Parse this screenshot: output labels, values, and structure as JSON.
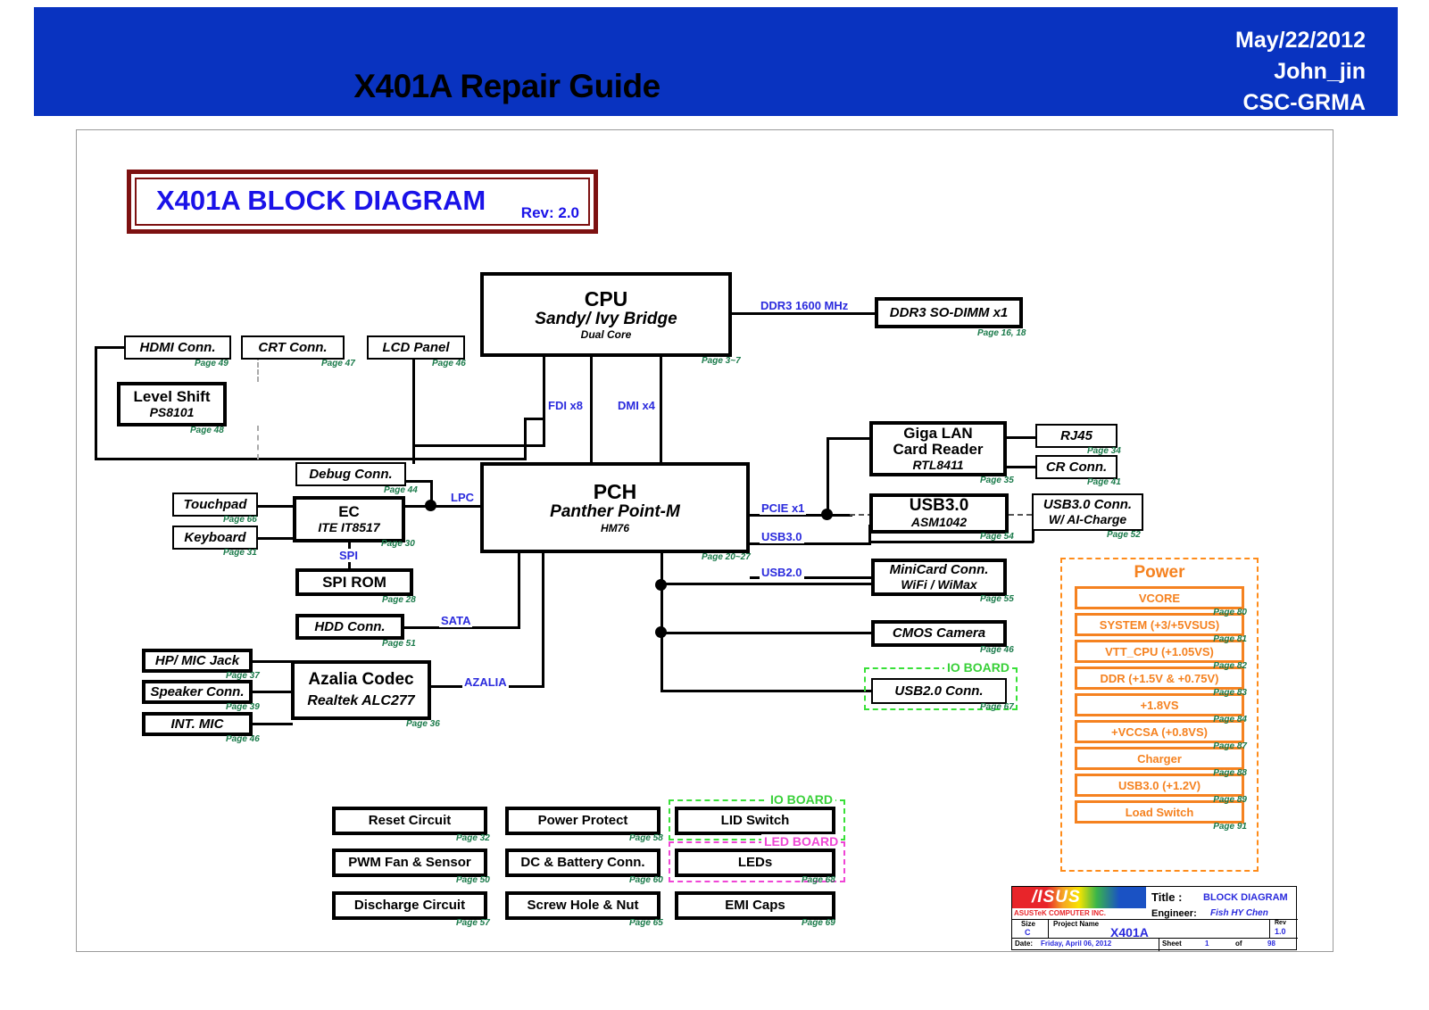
{
  "header": {
    "title": "X401A Repair Guide",
    "date": "May/22/2012",
    "author": "John_jin",
    "org": "CSC-GRMA",
    "bg_color": "#0933c0"
  },
  "diagram": {
    "title": "X401A BLOCK DIAGRAM",
    "revision": "Rev: 2.0",
    "border_color": "#7d1111",
    "title_color": "#1a12e8"
  },
  "blocks": {
    "cpu": {
      "l1": "CPU",
      "l2": "Sandy/ Ivy Bridge",
      "l3": "Dual Core",
      "page": "Page 3~7"
    },
    "ddr3_sodimm": {
      "l1": "DDR3 SO-DIMM x1",
      "page": "Page 16, 18"
    },
    "hdmi_conn": {
      "l1": "HDMI Conn.",
      "page": "Page 49"
    },
    "crt_conn": {
      "l1": "CRT Conn.",
      "page": "Page 47"
    },
    "lcd_panel": {
      "l1": "LCD Panel",
      "page": "Page 46"
    },
    "level_shift": {
      "l1": "Level Shift",
      "l2": "PS8101",
      "page": "Page 48"
    },
    "debug_conn": {
      "l1": "Debug Conn.",
      "page": "Page 44"
    },
    "touchpad": {
      "l1": "Touchpad",
      "page": "Page 66"
    },
    "keyboard": {
      "l1": "Keyboard",
      "page": "Page 31"
    },
    "ec": {
      "l1": "EC",
      "l2": "ITE IT8517",
      "page": "Page 30"
    },
    "spi_rom": {
      "l1": "SPI ROM",
      "page": "Page 28"
    },
    "pch": {
      "l1": "PCH",
      "l2": "Panther Point-M",
      "l3": "HM76",
      "page": "Page 20~27"
    },
    "hdd_conn": {
      "l1": "HDD Conn.",
      "page": "Page 51"
    },
    "hp_mic_jack": {
      "l1": "HP/ MIC Jack",
      "page": "Page 37"
    },
    "speaker_conn": {
      "l1": "Speaker Conn.",
      "page": "Page 39"
    },
    "int_mic": {
      "l1": "INT. MIC",
      "page": "Page 46"
    },
    "azalia_codec": {
      "l1": "Azalia Codec",
      "l2": "Realtek ALC277",
      "page": "Page 36"
    },
    "giga_lan": {
      "l1": "Giga LAN",
      "l1b": "Card Reader",
      "l2": "RTL8411",
      "page": "Page 35"
    },
    "rj45": {
      "l1": "RJ45",
      "page": "Page 34"
    },
    "cr_conn": {
      "l1": "CR Conn.",
      "page": "Page 41"
    },
    "usb30_ctrl": {
      "l1": "USB3.0",
      "l2": "ASM1042",
      "page": "Page 54"
    },
    "usb30_conn": {
      "l1": "USB3.0 Conn.",
      "l2": "W/ AI-Charge",
      "page": "Page 52"
    },
    "minicard_conn": {
      "l1": "MiniCard Conn.",
      "l2": "WiFi / WiMax",
      "page": "Page 55"
    },
    "cmos_camera": {
      "l1": "CMOS Camera",
      "page": "Page 46"
    },
    "usb20_conn": {
      "l1": "USB2.0 Conn.",
      "page": "Page 67"
    },
    "reset_circuit": {
      "l1": "Reset Circuit",
      "page": "Page 32"
    },
    "power_protect": {
      "l1": "Power Protect",
      "page": "Page 58"
    },
    "lid_switch": {
      "l1": "LID Switch",
      "page": "Page 63"
    },
    "pwm_fan": {
      "l1": "PWM Fan & Sensor",
      "page": "Page 50"
    },
    "dc_battery": {
      "l1": "DC & Battery Conn.",
      "page": "Page 60"
    },
    "leds": {
      "l1": "LEDs",
      "page": "Page 68"
    },
    "discharge_circuit": {
      "l1": "Discharge Circuit",
      "page": "Page 57"
    },
    "screw_hole": {
      "l1": "Screw Hole & Nut",
      "page": "Page 65"
    },
    "emi_caps": {
      "l1": "EMI Caps",
      "page": "Page 69"
    }
  },
  "signals": {
    "ddr3": "DDR3 1600 MHz",
    "fdi": "FDI x8",
    "dmi": "DMI x4",
    "lpc": "LPC",
    "spi": "SPI",
    "sata": "SATA",
    "azalia": "AZALIA",
    "pcie": "PCIE x1",
    "usb30": "USB3.0",
    "usb20": "USB2.0"
  },
  "groups": {
    "io_board": "IO BOARD",
    "led_board": "LED BOARD",
    "io_color": "#38d038",
    "led_color": "#ef45d5"
  },
  "power": {
    "title": "Power",
    "color": "#f58220",
    "rails": [
      {
        "label": "VCORE",
        "page": "Page 80"
      },
      {
        "label": "SYSTEM (+3/+5VSUS)",
        "page": "Page 81"
      },
      {
        "label": "VTT_CPU (+1.05VS)",
        "page": "Page 82"
      },
      {
        "label": "DDR (+1.5V & +0.75V)",
        "page": "Page 83"
      },
      {
        "label": "+1.8VS",
        "page": "Page 84"
      },
      {
        "label": "+VCCSA (+0.8VS)",
        "page": "Page 87"
      },
      {
        "label": "Charger",
        "page": "Page 88"
      },
      {
        "label": "USB3.0 (+1.2V)",
        "page": "Page 89"
      },
      {
        "label": "Load Switch",
        "page": "Page 91"
      }
    ]
  },
  "titleblock": {
    "logo_text": "/ISUS",
    "company": "ASUSTeK COMPUTER INC.",
    "title_key": "Title :",
    "title_value": "BLOCK DIAGRAM",
    "engineer_key": "Engineer:",
    "engineer_value": "Fish HY Chen",
    "size_key": "Size",
    "size_value": "C",
    "project_key": "Project Name",
    "project_value": "X401A",
    "rev_key": "Rev",
    "rev_value": "1.0",
    "date_key": "Date:",
    "date_value": "Friday, April 06, 2012",
    "sheet_key": "Sheet",
    "sheet_number": "1",
    "sheet_of": "of",
    "sheet_total": "98"
  }
}
